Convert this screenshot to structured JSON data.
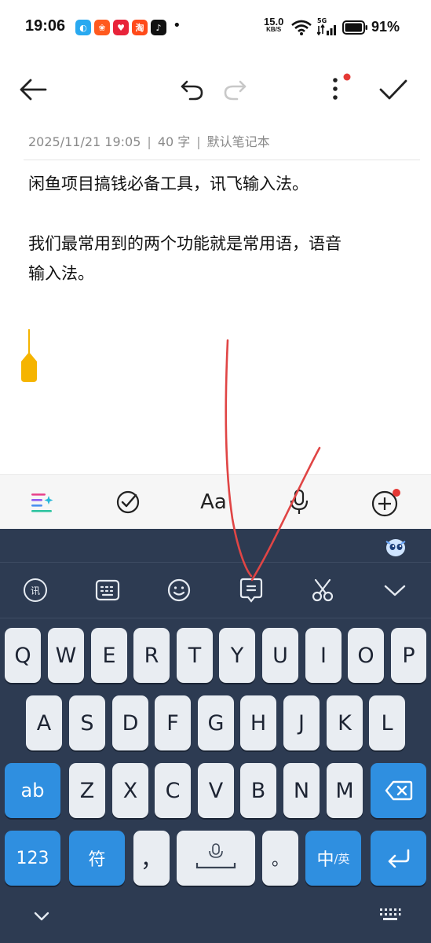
{
  "status": {
    "time": "19:06",
    "net_speed_value": "15.0",
    "net_speed_unit": "KB/S",
    "signal_label": "5G",
    "battery": "91%",
    "dot": "•"
  },
  "note": {
    "meta_date": "2025/11/21 19:05",
    "meta_sep1": "|",
    "meta_count": "40 字",
    "meta_sep2": "|",
    "meta_notebook": "默认笔记本",
    "line1": "闲鱼项目搞钱必备工具，讯飞输入法。",
    "line2": "我们最常用到的两个功能就是常用语，语音",
    "line3": "输入法。"
  },
  "editbar": {
    "format_label": "Aa"
  },
  "keyboard": {
    "row1": [
      "Q",
      "W",
      "E",
      "R",
      "T",
      "Y",
      "U",
      "I",
      "O",
      "P"
    ],
    "row2": [
      "A",
      "S",
      "D",
      "F",
      "G",
      "H",
      "J",
      "K",
      "L"
    ],
    "row3": [
      "Z",
      "X",
      "C",
      "V",
      "B",
      "N",
      "M"
    ],
    "shift_label": "ab",
    "num_label": "123",
    "sym_label": "符",
    "comma_label": "，",
    "period_label": "。",
    "lang_main": "中",
    "lang_alt": "/英"
  },
  "colors": {
    "accent_yellow": "#f5b400",
    "keyboard_bg": "#2d3b52",
    "key_blue": "#2f8fe0",
    "annotation_red": "#e04545",
    "notification_red": "#e53935"
  }
}
